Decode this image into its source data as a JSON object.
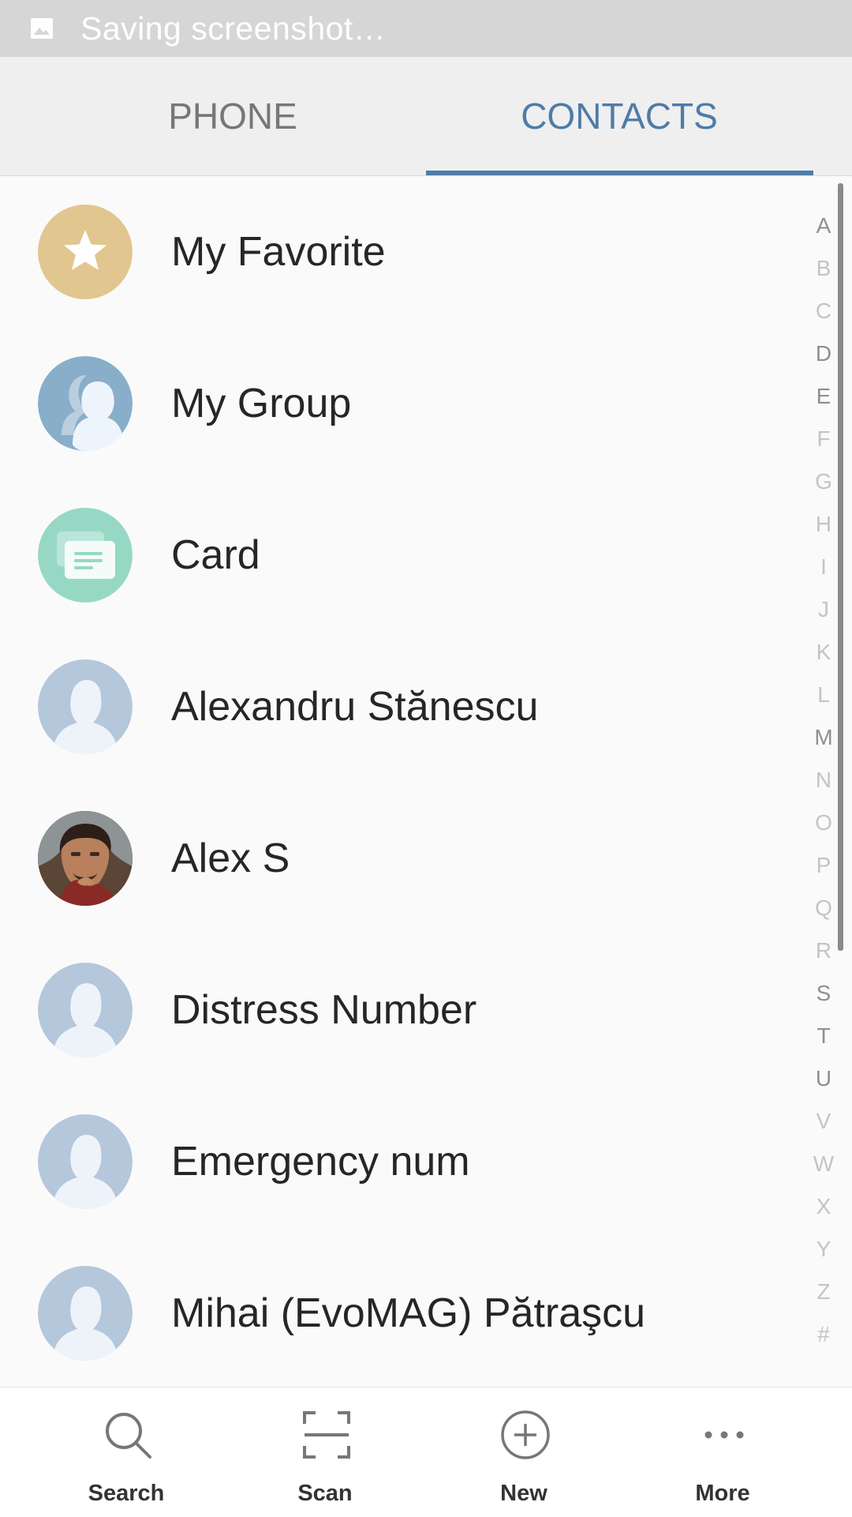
{
  "status_bar": {
    "text": "Saving screenshot…",
    "icon": "image-icon"
  },
  "tabs": [
    {
      "label": "PHONE",
      "selected": false
    },
    {
      "label": "CONTACTS",
      "selected": true
    }
  ],
  "colors": {
    "accent": "#4e7ca8",
    "favorite": "#e2c68f",
    "group": "#88aeca",
    "card": "#97d8c4",
    "contact_placeholder": "#b5c7db"
  },
  "contacts": [
    {
      "name": "My Favorite",
      "avatar": "star-icon"
    },
    {
      "name": "My Group",
      "avatar": "group-icon"
    },
    {
      "name": "Card",
      "avatar": "card-icon"
    },
    {
      "name": "Alexandru Stănescu",
      "avatar": "person-icon"
    },
    {
      "name": "Alex S",
      "avatar": "photo"
    },
    {
      "name": "Distress Number",
      "avatar": "person-icon"
    },
    {
      "name": "Emergency num",
      "avatar": "person-icon"
    },
    {
      "name": "Mihai (EvoMAG) Pătraşcu",
      "avatar": "person-icon"
    }
  ],
  "index_letters": [
    "A",
    "B",
    "C",
    "D",
    "E",
    "F",
    "G",
    "H",
    "I",
    "J",
    "K",
    "L",
    "M",
    "N",
    "O",
    "P",
    "Q",
    "R",
    "S",
    "T",
    "U",
    "V",
    "W",
    "X",
    "Y",
    "Z",
    "#"
  ],
  "bottom_bar": {
    "search": {
      "label": "Search",
      "icon": "search-icon"
    },
    "scan": {
      "label": "Scan",
      "icon": "scan-icon"
    },
    "new": {
      "label": "New",
      "icon": "add-circle-icon"
    },
    "more": {
      "label": "More",
      "icon": "more-icon"
    }
  }
}
